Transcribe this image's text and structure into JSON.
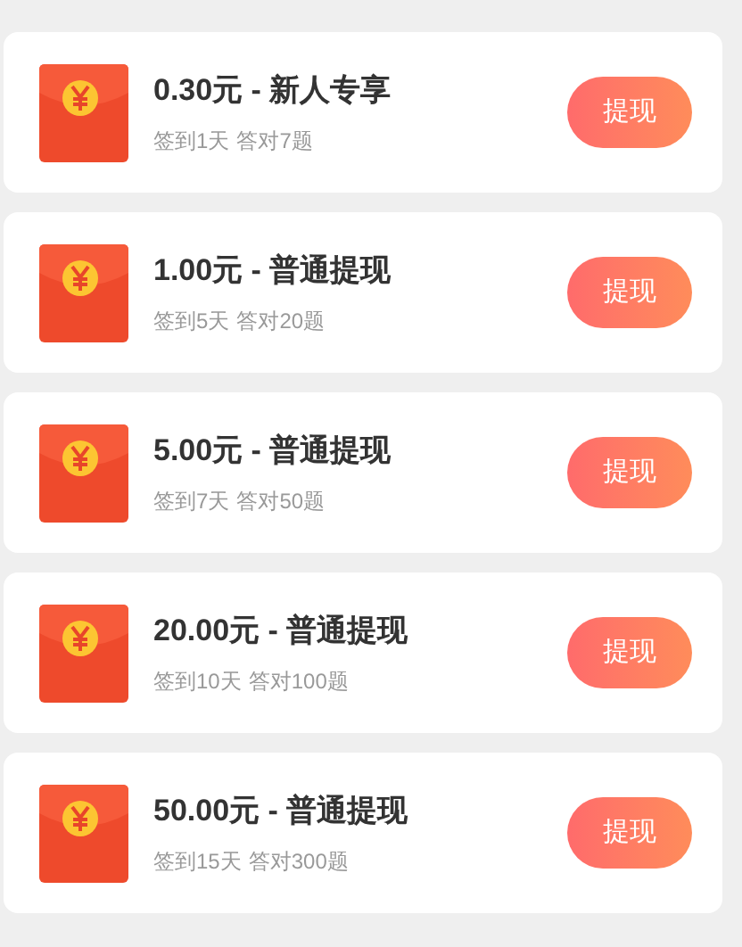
{
  "rewards": [
    {
      "title": "0.30元 - 新人专享",
      "conditions": [
        "签到1天",
        "答对7题"
      ],
      "button": "提现"
    },
    {
      "title": "1.00元 - 普通提现",
      "conditions": [
        "签到5天",
        "答对20题"
      ],
      "button": "提现"
    },
    {
      "title": "5.00元 - 普通提现",
      "conditions": [
        "签到7天",
        "答对50题"
      ],
      "button": "提现"
    },
    {
      "title": "20.00元 - 普通提现",
      "conditions": [
        "签到10天",
        "答对100题"
      ],
      "button": "提现"
    },
    {
      "title": "50.00元 - 普通提现",
      "conditions": [
        "签到15天",
        "答对300题"
      ],
      "button": "提现"
    }
  ]
}
